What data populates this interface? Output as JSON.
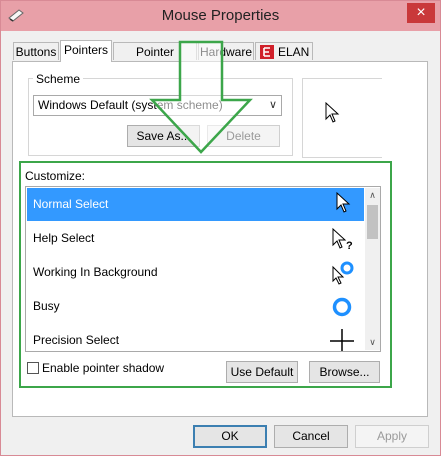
{
  "window": {
    "title": "Mouse Properties",
    "close_glyph": "×"
  },
  "tabs": [
    {
      "label": "Buttons",
      "active": false
    },
    {
      "label": "Pointers",
      "active": true
    },
    {
      "label": "Pointer Options",
      "active": false
    },
    {
      "label": "Hardware",
      "active": false
    },
    {
      "label": "ELAN",
      "active": false
    }
  ],
  "scheme": {
    "label": "Scheme",
    "selected": "Windows Default (system scheme)",
    "save_as_label": "Save As...",
    "delete_label": "Delete"
  },
  "customize": {
    "label": "Customize:",
    "items": [
      {
        "label": "Normal Select",
        "icon": "arrow-cursor-icon",
        "selected": true
      },
      {
        "label": "Help Select",
        "icon": "help-cursor-icon",
        "selected": false
      },
      {
        "label": "Working In Background",
        "icon": "working-cursor-icon",
        "selected": false
      },
      {
        "label": "Busy",
        "icon": "busy-cursor-icon",
        "selected": false
      },
      {
        "label": "Precision Select",
        "icon": "crosshair-cursor-icon",
        "selected": false
      }
    ]
  },
  "shadow": {
    "label": "Enable pointer shadow",
    "checked": false
  },
  "buttons": {
    "use_default": "Use Default",
    "browse": "Browse...",
    "ok": "OK",
    "cancel": "Cancel",
    "apply": "Apply"
  },
  "colors": {
    "titlebar": "#e8a0a8",
    "close": "#c9383a",
    "selection": "#3399ff",
    "annotation": "#3ca64a",
    "busy_ring": "#1e90ff"
  }
}
